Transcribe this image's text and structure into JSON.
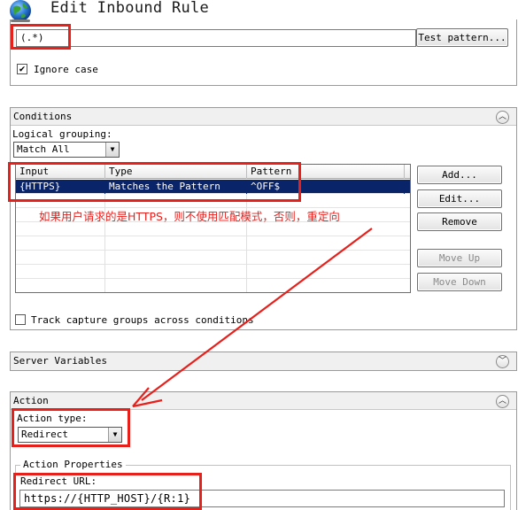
{
  "header": {
    "title": "Edit Inbound Rule"
  },
  "pattern": {
    "value": "(.*)",
    "test_button": "Test pattern..."
  },
  "ignore_case": {
    "label": "Ignore case",
    "checked": true,
    "check_glyph": "✔"
  },
  "conditions": {
    "title": "Conditions",
    "logical_grouping_label": "Logical grouping:",
    "logical_grouping_value": "Match All",
    "columns": [
      "Input",
      "Type",
      "Pattern"
    ],
    "rows": [
      {
        "input": "{HTTPS}",
        "type": "Matches the Pattern",
        "pattern": "^OFF$",
        "selected": true
      }
    ],
    "buttons": {
      "add": "Add...",
      "edit": "Edit...",
      "remove": "Remove",
      "move_up": "Move Up",
      "move_down": "Move Down"
    },
    "track_label": "Track capture groups across conditions",
    "annotation": "如果用户请求的是HTTPS，则不使用匹配模式，否则，重定向"
  },
  "server_variables": {
    "title": "Server Variables"
  },
  "action": {
    "title": "Action",
    "action_type_label": "Action type:",
    "action_type_value": "Redirect",
    "properties_label": "Action Properties",
    "redirect_url_label": "Redirect URL:",
    "redirect_url_value": "https://{HTTP_HOST}/{R:1}"
  },
  "colors": {
    "annotation_red": "#e8201c",
    "selection_blue": "#0a246a",
    "panel_header": "#f0f0f0"
  },
  "icons": {
    "globe": "globe-icon",
    "collapse": "chevron-up-icon",
    "expand": "chevron-down-icon",
    "dropdown": "dropdown-arrow-icon"
  }
}
